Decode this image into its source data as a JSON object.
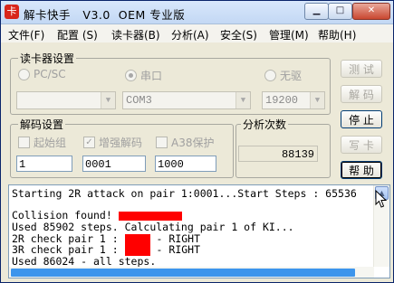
{
  "window": {
    "title": "解卡快手   V3.0  OEM 专业版",
    "icon_glyph": "卡",
    "controls": {
      "minimize": "▁",
      "maximize": "□",
      "close": "✕"
    }
  },
  "menu": [
    {
      "label": "文件(F)"
    },
    {
      "label": "配置 (S)"
    },
    {
      "label": "读卡器(B)"
    },
    {
      "label": "分析(A)"
    },
    {
      "label": "安全(S)"
    },
    {
      "label": "管理(M)"
    },
    {
      "label": "帮助(H)"
    }
  ],
  "reader_settings": {
    "legend": "读卡器设置",
    "radios": [
      {
        "label": "PC/SC",
        "selected": false
      },
      {
        "label": "串口",
        "selected": true
      },
      {
        "label": "无驱",
        "selected": false
      }
    ],
    "device_combo": {
      "value": ""
    },
    "port_combo": {
      "value": "COM3"
    },
    "baud_combo": {
      "value": "19200"
    }
  },
  "decode_settings": {
    "legend": "解码设置",
    "checkboxes": [
      {
        "label": "起始组",
        "checked": false
      },
      {
        "label": "增强解码",
        "checked": true
      },
      {
        "label": "A38保护",
        "checked": false
      }
    ],
    "fields": [
      "1",
      "0001",
      "1000"
    ]
  },
  "analysis_count": {
    "legend": "分析次数",
    "value": "88139"
  },
  "buttons": {
    "test": "测 试",
    "decode": "解 码",
    "stop": "停 止",
    "write": "写 卡",
    "help": "帮 助"
  },
  "log": {
    "lines": [
      {
        "text": "Starting 2R attack on pair 1:0001...Start Steps : 65536"
      },
      {
        "text": ""
      },
      {
        "text": "Collision found! ",
        "redacted_after": true
      },
      {
        "text": "Used 85902 steps. Calculating pair 1 of KI..."
      },
      {
        "text": "2R check pair 1 : ",
        "tail": " - RIGHT"
      },
      {
        "text": "3R check pair 1 : ",
        "tail": " - RIGHT"
      },
      {
        "text": "Used 86024 - all steps."
      }
    ]
  },
  "colors": {
    "redaction": "#ff0000",
    "scroll_thumb": "#3d95ec",
    "titlebar": "#c3d8f4"
  },
  "icons": [
    "app-icon",
    "minimize-icon",
    "maximize-icon",
    "close-icon",
    "scroll-up-icon",
    "mouse-cursor-icon"
  ]
}
